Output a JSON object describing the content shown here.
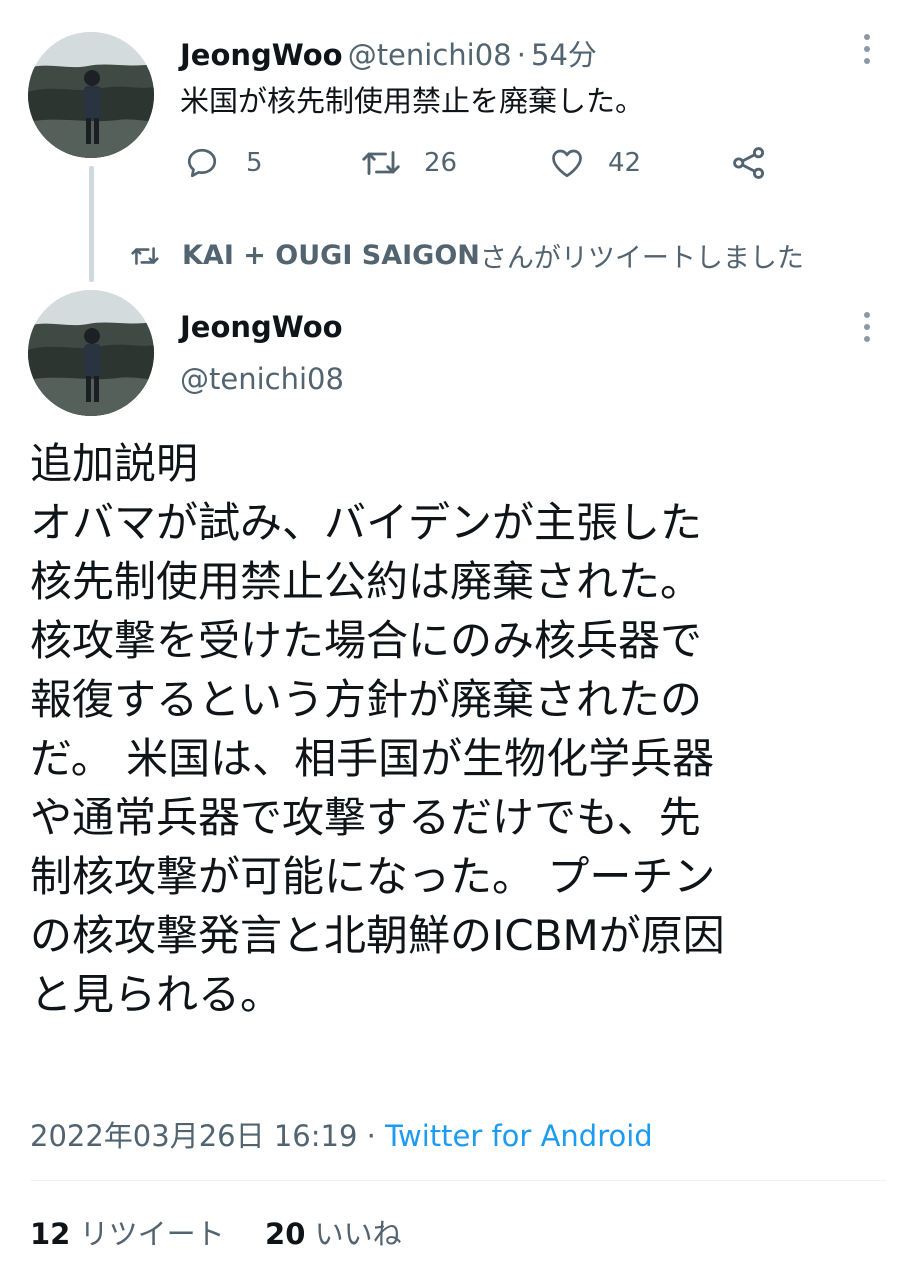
{
  "parent_tweet": {
    "display_name": "JeongWoo",
    "handle": "@tenichi08",
    "separator": "·",
    "time": "54分",
    "text": "米国が核先制使用禁止を廃棄した。",
    "actions": {
      "reply_count": "5",
      "retweet_count": "26",
      "like_count": "42"
    }
  },
  "retweet_notice": {
    "retweeter": "KAI + OUGI SAIGON",
    "suffix": "さんがリツイートしました"
  },
  "main_tweet": {
    "display_name": "JeongWoo",
    "handle": "@tenichi08",
    "text_lines": [
      "追加説明",
      "オバマが試み、バイデンが主張した",
      "核先制使用禁止公約は廃棄された。",
      "核攻撃を受けた場合にのみ核兵器で",
      "報復するという方針が廃棄されたの",
      "だ。 米国は、相手国が生物化学兵器",
      "や通常兵器で攻撃するだけでも、先",
      "制核攻撃が可能になった。 プーチン",
      "の核攻撃発言と北朝鮮のICBMが原因",
      "と見られる。"
    ],
    "timestamp": "2022年03月26日 16:19",
    "separator": "·",
    "source": "Twitter for Android",
    "stats": {
      "retweet_count": "12",
      "retweet_label": "リツイート",
      "like_count": "20",
      "like_label": "いいね"
    }
  },
  "colors": {
    "text_primary": "#0f1419",
    "text_secondary": "#536471",
    "link": "#1d9bf0",
    "thread_line": "#cfd9de"
  }
}
